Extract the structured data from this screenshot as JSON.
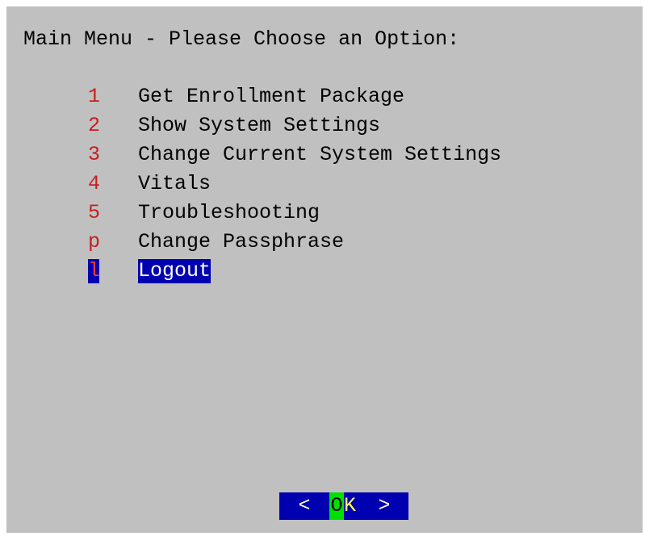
{
  "title": "Main Menu - Please Choose an Option:",
  "menu": {
    "items": [
      {
        "key": "1",
        "label": "Get Enrollment Package",
        "selected": false
      },
      {
        "key": "2",
        "label": "Show System Settings",
        "selected": false
      },
      {
        "key": "3",
        "label": "Change Current System Settings",
        "selected": false
      },
      {
        "key": "4",
        "label": "Vitals",
        "selected": false
      },
      {
        "key": "5",
        "label": "Troubleshooting",
        "selected": false
      },
      {
        "key": "p",
        "label": "Change Passphrase",
        "selected": false
      },
      {
        "key": "l",
        "label": "Logout",
        "selected": true
      }
    ]
  },
  "ok_button": {
    "left_bracket": "<",
    "hotkey": "O",
    "rest": "K",
    "right_bracket": ">"
  },
  "colors": {
    "background": "#c0c0c0",
    "key_text": "#c81e1e",
    "selection_bg": "#0000b0",
    "hotkey_bg": "#00e000"
  }
}
